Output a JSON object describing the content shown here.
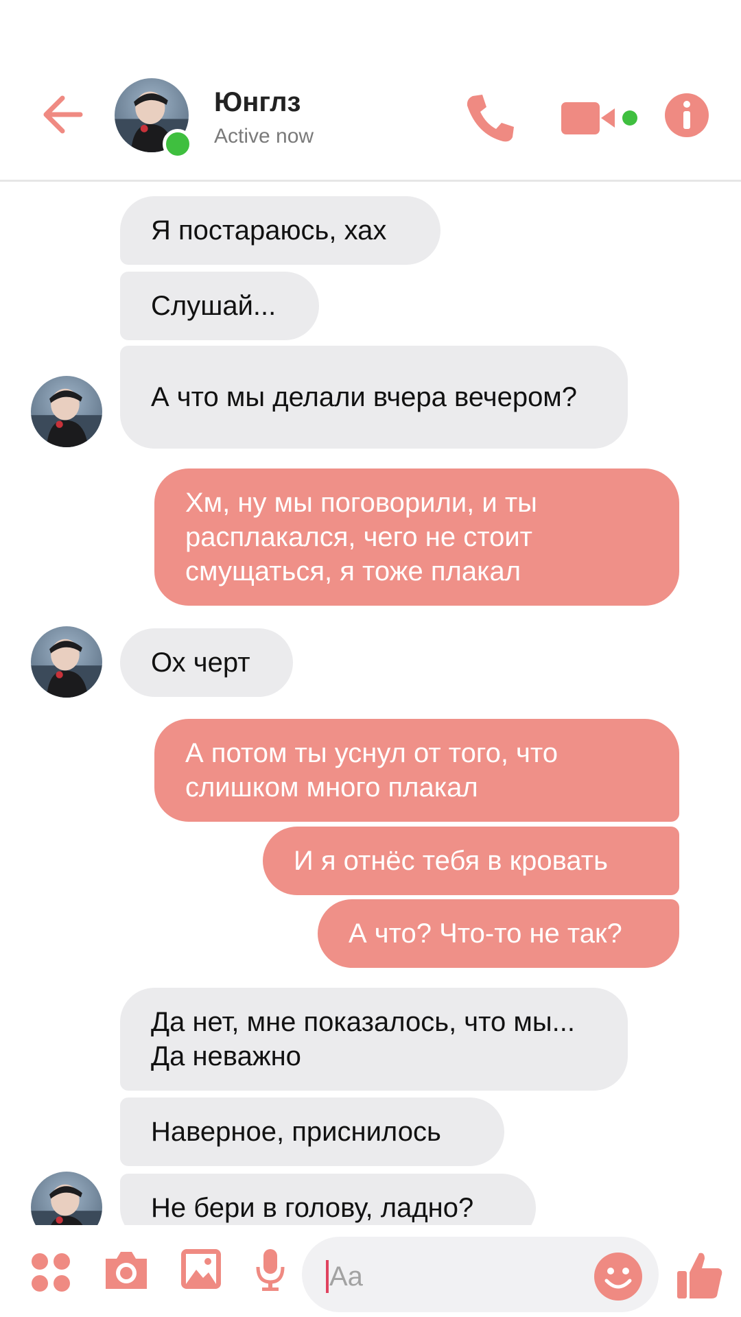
{
  "header": {
    "contact_name": "Юнглз",
    "status": "Active now"
  },
  "messages": [
    {
      "side": "in",
      "text": "Я постараюсь, хах"
    },
    {
      "side": "in",
      "text": "Слушай..."
    },
    {
      "side": "in",
      "text": "А что мы делали вчера вечером?"
    },
    {
      "side": "out",
      "text": "Хм, ну мы поговорили, и ты расплакался, чего не стоит смущаться, я тоже плакал"
    },
    {
      "side": "in",
      "text": "Ох черт"
    },
    {
      "side": "out",
      "text": "А потом ты уснул от того, что слишком много плакал"
    },
    {
      "side": "out",
      "text": "И я отнёс тебя в кровать"
    },
    {
      "side": "out",
      "text": "А что? Что-то не так?"
    },
    {
      "side": "in",
      "text": "Да нет, мне показалось, что мы... Да неважно"
    },
    {
      "side": "in",
      "text": "Наверное, приснилось"
    },
    {
      "side": "in",
      "text": "Не бери в голову, ладно?"
    }
  ],
  "composer": {
    "placeholder": "Aa"
  },
  "colors": {
    "accent": "#ef8a82",
    "outgoing_bubble": "#ef9088",
    "incoming_bubble": "#ebebed",
    "online": "#3fbf3f"
  },
  "icons": [
    "back-arrow-icon",
    "phone-icon",
    "video-camera-icon",
    "info-icon",
    "menu-dots-icon",
    "camera-icon",
    "image-icon",
    "microphone-icon",
    "smiley-icon",
    "thumbs-up-icon"
  ]
}
